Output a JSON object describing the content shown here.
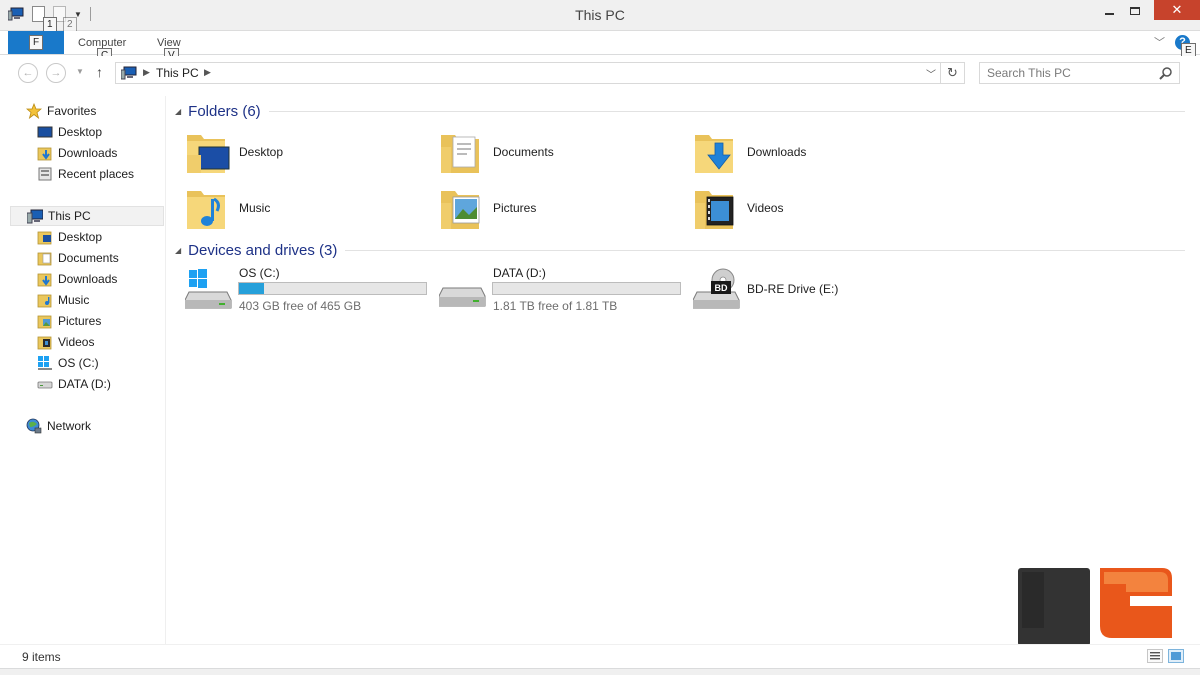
{
  "window": {
    "title": "This PC",
    "close_glyph": "✕"
  },
  "quick_access": {
    "keytips": [
      "1",
      "2"
    ]
  },
  "ribbon": {
    "file_tab_keytip": "F",
    "tabs": [
      {
        "label": "Computer",
        "keytip": "C"
      },
      {
        "label": "View",
        "keytip": "V"
      }
    ],
    "help_label": "?",
    "help_keytip": "E"
  },
  "navigation": {
    "breadcrumb": [
      "This PC"
    ],
    "search_placeholder": "Search This PC"
  },
  "nav_pane": {
    "favorites": {
      "label": "Favorites",
      "items": [
        "Desktop",
        "Downloads",
        "Recent places"
      ]
    },
    "this_pc": {
      "label": "This PC",
      "items": [
        "Desktop",
        "Documents",
        "Downloads",
        "Music",
        "Pictures",
        "Videos",
        "OS (C:)",
        "DATA (D:)"
      ]
    },
    "network": {
      "label": "Network"
    }
  },
  "content": {
    "folders_group": "Folders (6)",
    "folders": [
      "Desktop",
      "Documents",
      "Downloads",
      "Music",
      "Pictures",
      "Videos"
    ],
    "devices_group": "Devices and drives (3)",
    "drives": [
      {
        "name": "OS (C:)",
        "free_text": "403 GB free of 465 GB",
        "used_fraction": 0.133
      },
      {
        "name": "DATA (D:)",
        "free_text": "1.81 TB free of 1.81 TB",
        "used_fraction": 0.0
      },
      {
        "name": "BD-RE Drive (E:)",
        "badge": "BD"
      }
    ]
  },
  "status": {
    "item_count": "9 items"
  },
  "colors": {
    "accent": "#1979ca",
    "group_header": "#1e3287",
    "capacity_bar": "#26a0da",
    "close_button": "#c7432c"
  }
}
